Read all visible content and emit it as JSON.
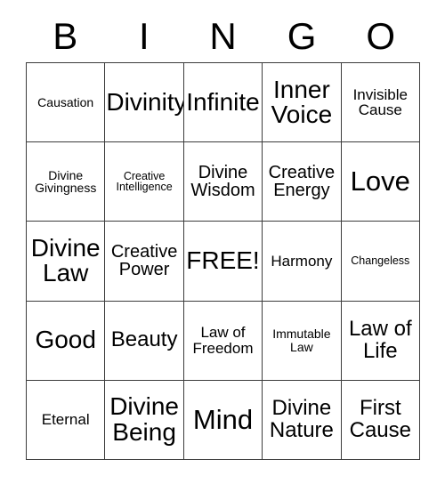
{
  "card": {
    "title": "BINGO",
    "header_letters": [
      "B",
      "I",
      "N",
      "G",
      "O"
    ],
    "grid_size": "5x5",
    "free_space_label": "FREE!",
    "colors": {
      "background": "#ffffff",
      "text": "#000000",
      "border": "#3c3c3c"
    },
    "rows": [
      [
        {
          "label": "Causation",
          "size": "sm"
        },
        {
          "label": "Divinity",
          "size": "xxl"
        },
        {
          "label": "Infinite",
          "size": "xxl"
        },
        {
          "label": "Inner\nVoice",
          "size": "xxl"
        },
        {
          "label": "Invisible\nCause",
          "size": "md"
        }
      ],
      [
        {
          "label": "Divine\nGivingness",
          "size": "sm"
        },
        {
          "label": "Creative\nIntelligence",
          "size": "xs"
        },
        {
          "label": "Divine\nWisdom",
          "size": "lg"
        },
        {
          "label": "Creative\nEnergy",
          "size": "lg"
        },
        {
          "label": "Love",
          "size": "xxxl"
        }
      ],
      [
        {
          "label": "Divine\nLaw",
          "size": "xxl"
        },
        {
          "label": "Creative\nPower",
          "size": "lg"
        },
        {
          "label": "FREE!",
          "size": "xxl"
        },
        {
          "label": "Harmony",
          "size": "md"
        },
        {
          "label": "Changeless",
          "size": "xs"
        }
      ],
      [
        {
          "label": "Good",
          "size": "xxl"
        },
        {
          "label": "Beauty",
          "size": "xl"
        },
        {
          "label": "Law of\nFreedom",
          "size": "md"
        },
        {
          "label": "Immutable\nLaw",
          "size": "sm"
        },
        {
          "label": "Law of\nLife",
          "size": "xl"
        }
      ],
      [
        {
          "label": "Eternal",
          "size": "md"
        },
        {
          "label": "Divine\nBeing",
          "size": "xxl"
        },
        {
          "label": "Mind",
          "size": "xxxl"
        },
        {
          "label": "Divine\nNature",
          "size": "xl"
        },
        {
          "label": "First\nCause",
          "size": "xl"
        }
      ]
    ]
  }
}
